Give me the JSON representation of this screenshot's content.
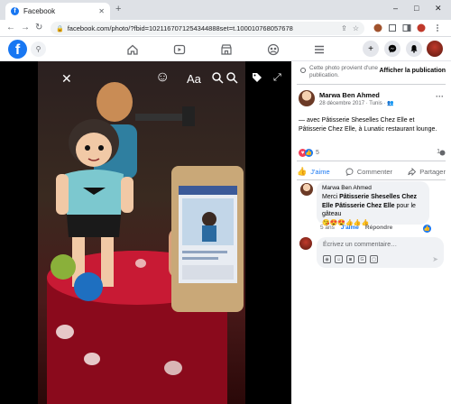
{
  "browser": {
    "tab_title": "Facebook",
    "tab_close": "✕",
    "new_tab": "+",
    "url": "facebook.com/photo/?fbid=1021167071254344888set=t.100010768057678",
    "window": {
      "minimize": "–",
      "maximize": "□",
      "close": "✕"
    }
  },
  "fb_header": {
    "logo": "f",
    "nav": [
      "home-icon",
      "watch-icon",
      "marketplace-icon",
      "groups-icon",
      "menu-icon"
    ]
  },
  "viewer": {
    "close": "✕",
    "tools": {
      "text": "Aa",
      "face": "☺",
      "expand": "⤢"
    }
  },
  "panel": {
    "notice_text": "Cette photo provient d'une publication.",
    "notice_button": "Afficher la publication",
    "post": {
      "author": "Marwa Ben Ahmed",
      "date": "28 décembre 2017 · Tunis ·",
      "text": "— avec Pâtisserie Sheselles Chez Elle et Pâtisserie Chez Elle, à Lunatic restaurant lounge.",
      "reactions_count": "5",
      "comments_count": "1"
    },
    "actions": {
      "like": "J'aime",
      "comment": "Commenter",
      "share": "Partager"
    },
    "comment": {
      "author": "Marwa Ben Ahmed",
      "text_prefix": "Merci ",
      "mention1": "Pâtisserie Sheselles Chez Elle",
      "text_mid": " ",
      "mention2": "Pâtisserie Chez Elle",
      "text_suffix": " pour le gâteau",
      "emojis": "😘😍😍👍👍👍",
      "age": "5 ans",
      "like": "J'aime",
      "reply": "Répondre"
    },
    "composer_placeholder": "Écrivez un commentaire…"
  }
}
